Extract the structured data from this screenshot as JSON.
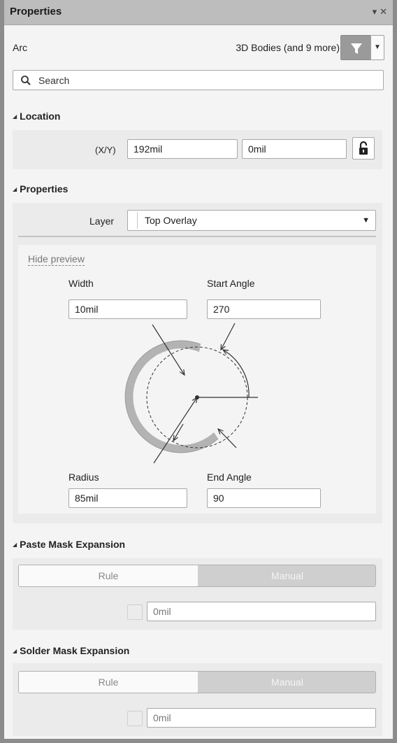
{
  "window": {
    "title": "Properties",
    "pin_icon": "pin-down-icon",
    "close_icon": "close-icon"
  },
  "header": {
    "object_type": "Arc",
    "filter_text": "3D Bodies (and 9 more)",
    "filter_icon": "funnel-icon",
    "filter_dropdown_icon": "caret-down-icon"
  },
  "search": {
    "placeholder": "Search",
    "value": ""
  },
  "location": {
    "title": "Location",
    "xy_label": "(X/Y)",
    "x_value": "192mil",
    "y_value": "0mil",
    "lock_icon": "padlock-open-icon"
  },
  "properties": {
    "title": "Properties",
    "layer_label": "Layer",
    "layer_value": "Top Overlay",
    "hide_preview": "Hide preview",
    "width_label": "Width",
    "width_value": "10mil",
    "start_angle_label": "Start Angle",
    "start_angle_value": "270",
    "radius_label": "Radius",
    "radius_value": "85mil",
    "end_angle_label": "End Angle",
    "end_angle_value": "90"
  },
  "paste_mask": {
    "title": "Paste Mask Expansion",
    "rule_label": "Rule",
    "manual_label": "Manual",
    "value": "0mil"
  },
  "solder_mask": {
    "title": "Solder Mask Expansion",
    "rule_label": "Rule",
    "manual_label": "Manual",
    "value": "0mil"
  },
  "colors": {
    "titlebar": "#bdbdbd",
    "panel": "#f4f4f4",
    "section": "#ebebeb",
    "toggle_selected": "#cfcfcf"
  }
}
